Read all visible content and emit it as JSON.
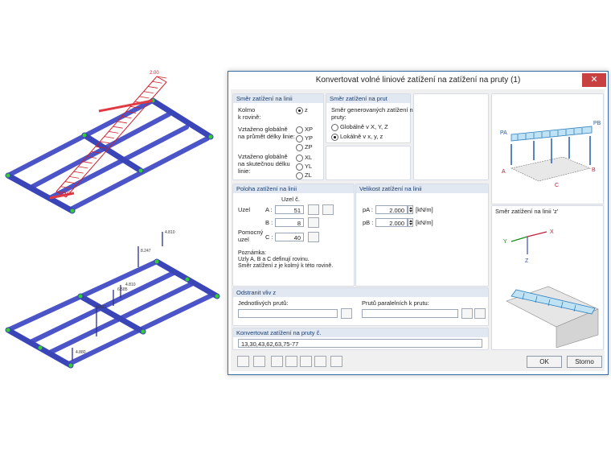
{
  "model": {
    "top_load_label_top": "2.00",
    "top_load_label_bottom": "2.00",
    "bottom_labels": [
      "4.810",
      "8.247",
      "4.810",
      "6.585",
      "9.621",
      "4.880"
    ]
  },
  "dialog": {
    "title": "Konvertovat volné liniové zatížení na zatížení na pruty  (1)",
    "close_label": "✕",
    "direction_line": {
      "header": "Směr zatížení na linii",
      "perpendicular_label": "Kolmo\nk rovině:",
      "z_label": "z",
      "projected_label": "Vztaženo globálně\nna průmět délky linie:",
      "xp_label": "XP",
      "yp_label": "YP",
      "zp_label": "ZP",
      "true_length_label": "Vztaženo globálně\nna skutečnou délku\nlinie:",
      "xl_label": "XL",
      "yl_label": "YL",
      "zl_label": "ZL",
      "selected": "z"
    },
    "direction_member": {
      "header": "Směr zatížení na prut",
      "description": "Směr generovaných zatížení na\npruty:",
      "global_label": "Globálně v X, Y, Z",
      "local_label": "Lokálně v x, y, z",
      "selected": "local"
    },
    "position": {
      "header": "Poloha zatížení na linii",
      "node_no_label": "Uzel č.",
      "node_label": "Uzel",
      "a_label": "A :",
      "a_value": "51",
      "b_label": "B :",
      "b_value": "8",
      "aux_label": "Pomocný\nuzel",
      "c_label": "C :",
      "c_value": "40",
      "note": "Poznámka:\nUzly A, B a C definují rovinu.\nSměr zatížení z je kolmý k této rovině."
    },
    "magnitude": {
      "header": "Velikost zatížení na linii",
      "pa_label": "pA :",
      "pa_value": "2.000",
      "pa_unit": "[kN/m]",
      "pb_label": "pB :",
      "pb_value": "2.000",
      "pb_unit": "[kN/m]"
    },
    "remove": {
      "header": "Odstranit vliv z",
      "individual_label": "Jednotlivých prutů:",
      "individual_value": "",
      "parallel_label": "Prutů paralelních k prutu:",
      "parallel_value": ""
    },
    "convert": {
      "header": "Konvertovat zatížení na pruty č.",
      "value": "13,30,43,62,63,75-77"
    },
    "preview": {
      "top_labels": {
        "pa": "PA",
        "pb": "PB",
        "a": "A",
        "b": "B",
        "c": "C"
      },
      "caption": "Směr zatížení na linii 'z'",
      "axis_x": "X",
      "axis_y": "Y",
      "axis_z": "Z"
    },
    "ok_label": "OK",
    "cancel_label": "Storno"
  },
  "colors": {
    "member_blue": "#4b55c8",
    "load_red": "#d0202a",
    "header_bg": "#e1e8f2",
    "accent_blue": "#3a6ea5"
  }
}
